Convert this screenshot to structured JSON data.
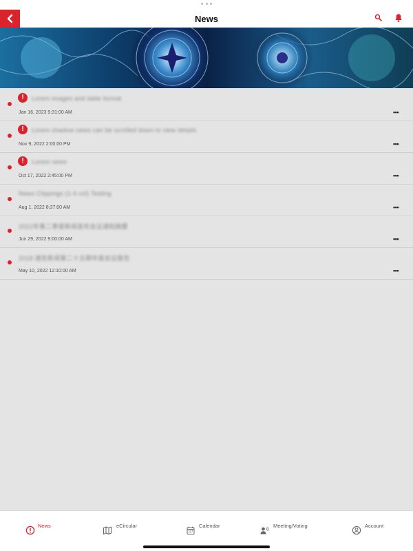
{
  "header": {
    "title": "News",
    "back_icon": "chevron-left-icon",
    "search_icon": "search-icon",
    "notification_icon": "bell-icon"
  },
  "colors": {
    "accent": "#d9232d",
    "background": "#e4e4e4",
    "header_bg": "#ffffff",
    "tabbar_bg": "#ffffff",
    "inactive_tab": "#555555"
  },
  "news": {
    "items": [
      {
        "title": "Lorem images and table format",
        "date": "Jan 16, 2023 9:31:00 AM",
        "alert": true,
        "unread": true,
        "more": "•••"
      },
      {
        "title": "Lorem shadow news can be scrolled down to view details",
        "date": "Nov 9, 2022 2:00:00 PM",
        "alert": true,
        "unread": true,
        "more": "•••"
      },
      {
        "title": "Lorem news",
        "date": "Oct 17, 2022 2:45:00 PM",
        "alert": true,
        "unread": true,
        "more": "•••"
      },
      {
        "title": "News Clippings (1-4 col) Testing",
        "date": "Aug 1, 2022 8:37:00 AM",
        "alert": false,
        "unread": true,
        "more": "•••"
      },
      {
        "title": "2022年第二季度新闻发布会议通知摘要",
        "date": "Jun 29, 2022 9:00:00 AM",
        "alert": false,
        "unread": true,
        "more": "•••"
      },
      {
        "title": "2018 通告新闻第二十五期年度会议报告",
        "date": "May 10, 2022 12:10:00 AM",
        "alert": false,
        "unread": true,
        "more": "•••"
      }
    ]
  },
  "tabs": [
    {
      "label": "News",
      "icon": "alert-circle-icon",
      "active": true
    },
    {
      "label": "eCircular",
      "icon": "map-icon",
      "active": false
    },
    {
      "label": "Calendar",
      "icon": "calendar-icon",
      "active": false
    },
    {
      "label": "Meeting/Voting",
      "icon": "speaker-person-icon",
      "active": false
    },
    {
      "label": "Account",
      "icon": "user-circle-icon",
      "active": false
    }
  ]
}
